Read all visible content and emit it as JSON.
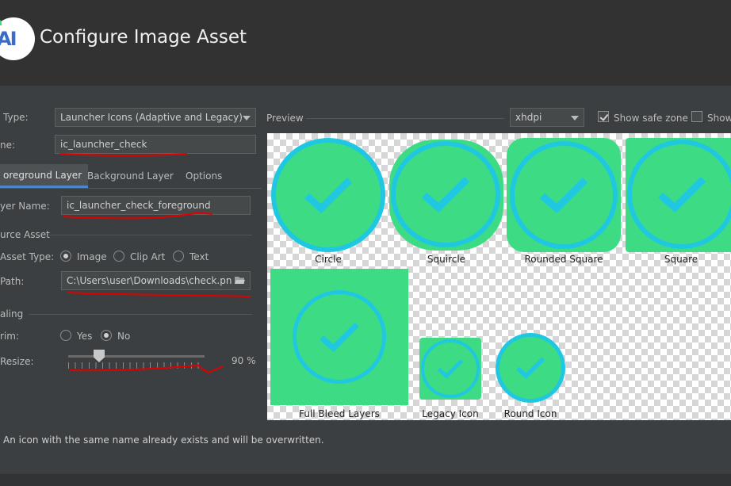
{
  "header": {
    "title": "Configure Image Asset",
    "logo_text": "AI"
  },
  "form": {
    "icon_type_label": "Type:",
    "icon_type_value": "Launcher Icons (Adaptive and Legacy)",
    "name_label": "ne:",
    "name_value": "ic_launcher_check"
  },
  "tabs": [
    "oreground Layer",
    "Background Layer",
    "Options"
  ],
  "foreground": {
    "layer_name_label": "yer Name:",
    "layer_name_value": "ic_launcher_check_foreground",
    "source_asset_label": "urce Asset",
    "asset_type_label": "Asset Type:",
    "asset_types": [
      "Image",
      "Clip Art",
      "Text"
    ],
    "asset_type_selected": "Image",
    "path_label": "Path:",
    "path_value": "C:\\Users\\user\\Downloads\\check.pn",
    "scaling_label": "aling",
    "trim_label": "rim:",
    "trim_options": [
      "Yes",
      "No"
    ],
    "trim_selected": "No",
    "resize_label": "Resize:",
    "resize_value_text": "90 %",
    "resize_fraction": 0.24
  },
  "preview": {
    "label": "Preview",
    "density": "xhdpi",
    "show_safe_zone_label": "Show safe zone",
    "show_safe_zone_checked": true,
    "show_grid_label": "Show",
    "show_grid_checked": false,
    "icons": [
      "Circle",
      "Squircle",
      "Rounded Square",
      "Square",
      "Full Bleed Layers",
      "Legacy Icon",
      "Round Icon"
    ]
  },
  "footer": {
    "message": "An icon with the same name already exists and will be overwritten."
  },
  "colors": {
    "icon_green": "#3ddc84",
    "icon_ring": "#1fc8e0",
    "annotation": "#e00000"
  }
}
